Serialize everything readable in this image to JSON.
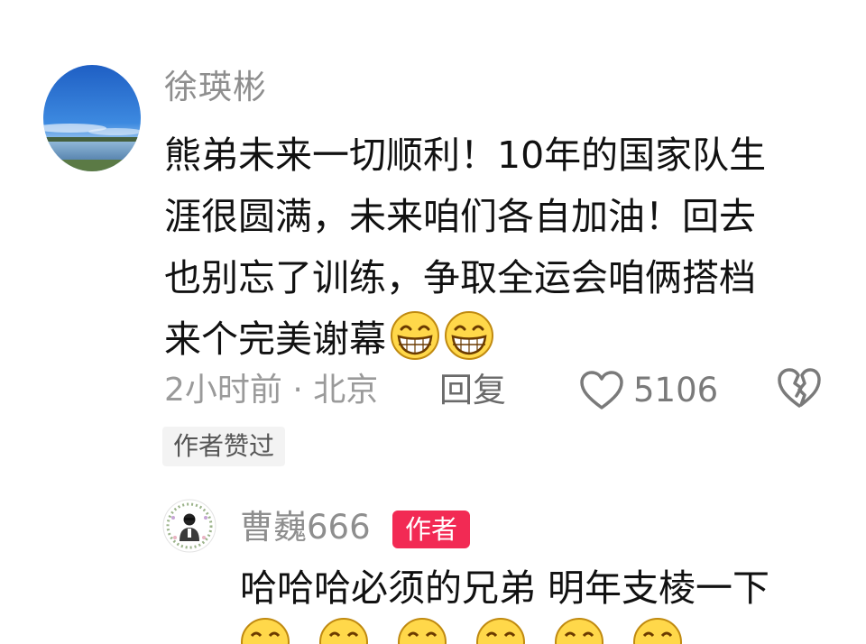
{
  "comment": {
    "username": "徐瑛彬",
    "text_lines": [
      "熊弟未来一切顺利！10年的国家队生",
      "涯很圆满，未来咱们各自加油！回去",
      "也别忘了训练，争取全运会咱俩搭档",
      "来个完美谢幕"
    ],
    "emojis": [
      "grinning-face-icon",
      "grinning-face-icon"
    ],
    "meta": "2小时前 · 北京",
    "reply_label": "回复",
    "like_count": "5106",
    "author_liked_badge": "作者赞过"
  },
  "reply": {
    "username": "曹巍666",
    "author_badge": "作者",
    "text": "哈哈哈必须的兄弟 明年支棱一下",
    "emojis": [
      "grinning-face-icon",
      "grinning-face-icon",
      "grinning-face-icon",
      "grinning-face-icon",
      "grinning-face-icon",
      "grinning-face-icon"
    ]
  },
  "colors": {
    "author_badge_bg": "#f22a54",
    "username_gray": "#8e8e8e",
    "meta_gray": "#9a9a9a",
    "text_black": "#111111"
  }
}
